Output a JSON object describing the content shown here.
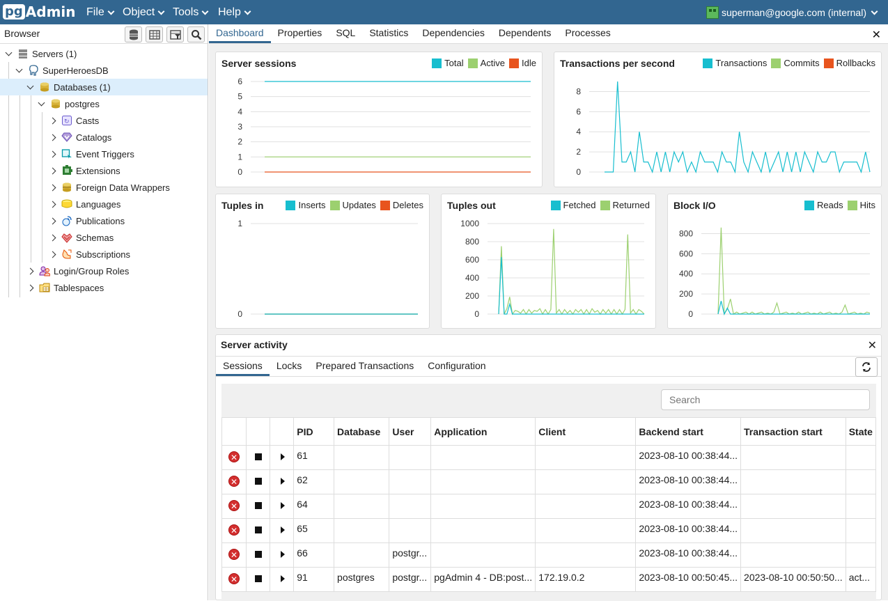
{
  "app": {
    "logo_pg": "pg",
    "logo_admin": "Admin"
  },
  "menu": [
    "File",
    "Object",
    "Tools",
    "Help"
  ],
  "user": "superman@google.com (internal)",
  "browser": {
    "title": "Browser",
    "tree": [
      {
        "label": "Servers (1)",
        "icon": "servers-icon"
      },
      {
        "label": "SuperHeroesDB",
        "icon": "elephant-icon"
      },
      {
        "label": "Databases (1)",
        "icon": "databases-icon"
      },
      {
        "label": "postgres",
        "icon": "database-icon"
      },
      {
        "label": "Casts",
        "icon": "casts-icon"
      },
      {
        "label": "Catalogs",
        "icon": "catalogs-icon"
      },
      {
        "label": "Event Triggers",
        "icon": "event-triggers-icon"
      },
      {
        "label": "Extensions",
        "icon": "extensions-icon"
      },
      {
        "label": "Foreign Data Wrappers",
        "icon": "fdw-icon"
      },
      {
        "label": "Languages",
        "icon": "languages-icon"
      },
      {
        "label": "Publications",
        "icon": "publications-icon"
      },
      {
        "label": "Schemas",
        "icon": "schemas-icon"
      },
      {
        "label": "Subscriptions",
        "icon": "subscriptions-icon"
      },
      {
        "label": "Login/Group Roles",
        "icon": "roles-icon"
      },
      {
        "label": "Tablespaces",
        "icon": "tablespaces-icon"
      }
    ]
  },
  "tabs": [
    "Dashboard",
    "Properties",
    "SQL",
    "Statistics",
    "Dependencies",
    "Dependents",
    "Processes"
  ],
  "colors": {
    "teal": "#17becf",
    "green": "#9cd06f",
    "orange": "#e8541e",
    "brand": "#326690"
  },
  "charts": {
    "server_sessions": {
      "title": "Server sessions",
      "legend": [
        "Total",
        "Active",
        "Idle"
      ]
    },
    "tps": {
      "title": "Transactions per second",
      "legend": [
        "Transactions",
        "Commits",
        "Rollbacks"
      ]
    },
    "tuples_in": {
      "title": "Tuples in",
      "legend": [
        "Inserts",
        "Updates",
        "Deletes"
      ]
    },
    "tuples_out": {
      "title": "Tuples out",
      "legend": [
        "Fetched",
        "Returned"
      ]
    },
    "block_io": {
      "title": "Block I/O",
      "legend": [
        "Reads",
        "Hits"
      ]
    }
  },
  "chart_data": [
    {
      "type": "line",
      "title": "Server sessions",
      "ylim": [
        0,
        6
      ],
      "yticks": [
        0,
        1,
        2,
        3,
        4,
        5,
        6
      ],
      "series": [
        {
          "name": "Total",
          "values": [
            6,
            6,
            6,
            6,
            6,
            6,
            6,
            6,
            6,
            6
          ]
        },
        {
          "name": "Active",
          "values": [
            1,
            1,
            1,
            1,
            1,
            1,
            1,
            1,
            1,
            1
          ]
        },
        {
          "name": "Idle",
          "values": [
            0,
            0,
            0,
            0,
            0,
            0,
            0,
            0,
            0,
            0
          ]
        }
      ]
    },
    {
      "type": "line",
      "title": "Transactions per second",
      "ylim": [
        0,
        9
      ],
      "yticks": [
        0,
        2,
        4,
        6,
        8
      ],
      "series": [
        {
          "name": "Transactions",
          "values": [
            0,
            0,
            0,
            9,
            1,
            1,
            2,
            0,
            4,
            1,
            1,
            0,
            2,
            0,
            2,
            0,
            2,
            1,
            2,
            0,
            1,
            0,
            2,
            1,
            1,
            1,
            0,
            2,
            1,
            1,
            0,
            4,
            1,
            0,
            2,
            1,
            0,
            2,
            0,
            1,
            2,
            0,
            2,
            0,
            2,
            0,
            2,
            1,
            0,
            2,
            1,
            1,
            2,
            2,
            0,
            1,
            1,
            1,
            1,
            0,
            2,
            0
          ]
        },
        {
          "name": "Commits",
          "values": []
        },
        {
          "name": "Rollbacks",
          "values": []
        }
      ]
    },
    {
      "type": "line",
      "title": "Tuples in",
      "ylim": [
        0,
        1
      ],
      "yticks": [
        0,
        1
      ],
      "series": [
        {
          "name": "Inserts",
          "values": [
            0,
            0,
            0,
            0,
            0,
            0,
            0,
            0
          ]
        },
        {
          "name": "Updates",
          "values": [
            0,
            0,
            0,
            0,
            0,
            0,
            0,
            0
          ]
        },
        {
          "name": "Deletes",
          "values": [
            0,
            0,
            0,
            0,
            0,
            0,
            0,
            0
          ]
        }
      ]
    },
    {
      "type": "line",
      "title": "Tuples out",
      "ylim": [
        0,
        1000
      ],
      "yticks": [
        0,
        200,
        400,
        600,
        800,
        1000
      ],
      "series": [
        {
          "name": "Fetched",
          "values": [
            0,
            630,
            0,
            0,
            110,
            0,
            0,
            0,
            0,
            0,
            0,
            0,
            0,
            0,
            0,
            0,
            0,
            0,
            0,
            0,
            0,
            0,
            0,
            0,
            0,
            0,
            0,
            0,
            0,
            0,
            0,
            0,
            0,
            0,
            0,
            0,
            0,
            0,
            0,
            0,
            0,
            0,
            0,
            0,
            0,
            0,
            0,
            0,
            0,
            0,
            0,
            0,
            0,
            0
          ]
        },
        {
          "name": "Returned",
          "values": [
            0,
            750,
            0,
            60,
            190,
            0,
            40,
            30,
            10,
            50,
            0,
            50,
            10,
            40,
            30,
            60,
            0,
            50,
            0,
            50,
            940,
            10,
            50,
            0,
            50,
            10,
            40,
            0,
            50,
            20,
            50,
            0,
            50,
            0,
            60,
            20,
            40,
            0,
            50,
            10,
            50,
            0,
            50,
            0,
            50,
            0,
            50,
            880,
            10,
            50,
            0,
            50,
            30,
            0
          ]
        }
      ]
    },
    {
      "type": "line",
      "title": "Block I/O",
      "ylim": [
        0,
        900
      ],
      "yticks": [
        0,
        200,
        400,
        600,
        800
      ],
      "series": [
        {
          "name": "Reads",
          "values": [
            0,
            130,
            0,
            60,
            0,
            0,
            0,
            0,
            0,
            0,
            0,
            0,
            0,
            0,
            0,
            0,
            0,
            0,
            0,
            0,
            0,
            0,
            0,
            0,
            0,
            0,
            0,
            0,
            0,
            0,
            0,
            0,
            0,
            0,
            0,
            0,
            0,
            0,
            0,
            0,
            0,
            0,
            0,
            0,
            0,
            0,
            0,
            0,
            0,
            0
          ]
        },
        {
          "name": "Hits",
          "values": [
            0,
            860,
            0,
            50,
            150,
            0,
            20,
            0,
            10,
            20,
            0,
            20,
            0,
            10,
            20,
            0,
            10,
            0,
            20,
            110,
            0,
            10,
            20,
            0,
            10,
            0,
            20,
            0,
            10,
            20,
            0,
            10,
            0,
            20,
            0,
            10,
            20,
            0,
            10,
            0,
            20,
            90,
            0,
            10,
            20,
            0,
            10,
            0,
            20,
            10
          ]
        }
      ]
    }
  ],
  "activity": {
    "title": "Server activity",
    "subtabs": [
      "Sessions",
      "Locks",
      "Prepared Transactions",
      "Configuration"
    ],
    "search_placeholder": "Search",
    "columns": [
      "",
      "",
      "",
      "PID",
      "Database",
      "User",
      "Application",
      "Client",
      "Backend start",
      "Transaction start",
      "State"
    ],
    "rows": [
      {
        "pid": "61",
        "database": "",
        "user": "",
        "application": "",
        "client": "",
        "backend_start": "2023-08-10 00:38:44...",
        "transaction_start": "",
        "state": ""
      },
      {
        "pid": "62",
        "database": "",
        "user": "",
        "application": "",
        "client": "",
        "backend_start": "2023-08-10 00:38:44...",
        "transaction_start": "",
        "state": ""
      },
      {
        "pid": "64",
        "database": "",
        "user": "",
        "application": "",
        "client": "",
        "backend_start": "2023-08-10 00:38:44...",
        "transaction_start": "",
        "state": ""
      },
      {
        "pid": "65",
        "database": "",
        "user": "",
        "application": "",
        "client": "",
        "backend_start": "2023-08-10 00:38:44...",
        "transaction_start": "",
        "state": ""
      },
      {
        "pid": "66",
        "database": "",
        "user": "postgr...",
        "application": "",
        "client": "",
        "backend_start": "2023-08-10 00:38:44...",
        "transaction_start": "",
        "state": ""
      },
      {
        "pid": "91",
        "database": "postgres",
        "user": "postgr...",
        "application": "pgAdmin 4 - DB:post...",
        "client": "172.19.0.2",
        "backend_start": "2023-08-10 00:50:45...",
        "transaction_start": "2023-08-10 00:50:50...",
        "state": "act..."
      }
    ]
  }
}
